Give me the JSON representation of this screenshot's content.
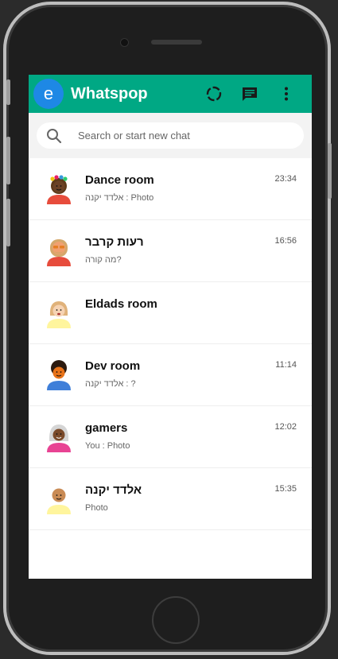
{
  "header": {
    "avatar_letter": "e",
    "title": "Whatspop",
    "icons": [
      "status-icon",
      "new-chat-icon",
      "menu-icon"
    ],
    "color": "#00a884"
  },
  "search": {
    "placeholder": "Search or start new chat"
  },
  "chats": [
    {
      "name": "Dance room",
      "time": "23:34",
      "last": "אלדד יקנה : Photo",
      "avatar": "woman-flowers-avatar"
    },
    {
      "name": "רעות קרבר",
      "time": "16:56",
      "last": "מה קורה?",
      "avatar": "man-sunglasses-avatar"
    },
    {
      "name": "Eldads room",
      "time": "",
      "last": "",
      "avatar": "blonde-woman-avatar"
    },
    {
      "name": "Dev room",
      "time": "11:14",
      "last": "אלדד יקנה : ?",
      "avatar": "curly-man-avatar"
    },
    {
      "name": "gamers",
      "time": "12:02",
      "last": "You : Photo",
      "avatar": "gray-hair-woman-avatar"
    },
    {
      "name": "אלדד יקנה",
      "time": "15:35",
      "last": "Photo",
      "avatar": "bald-man-avatar"
    }
  ]
}
